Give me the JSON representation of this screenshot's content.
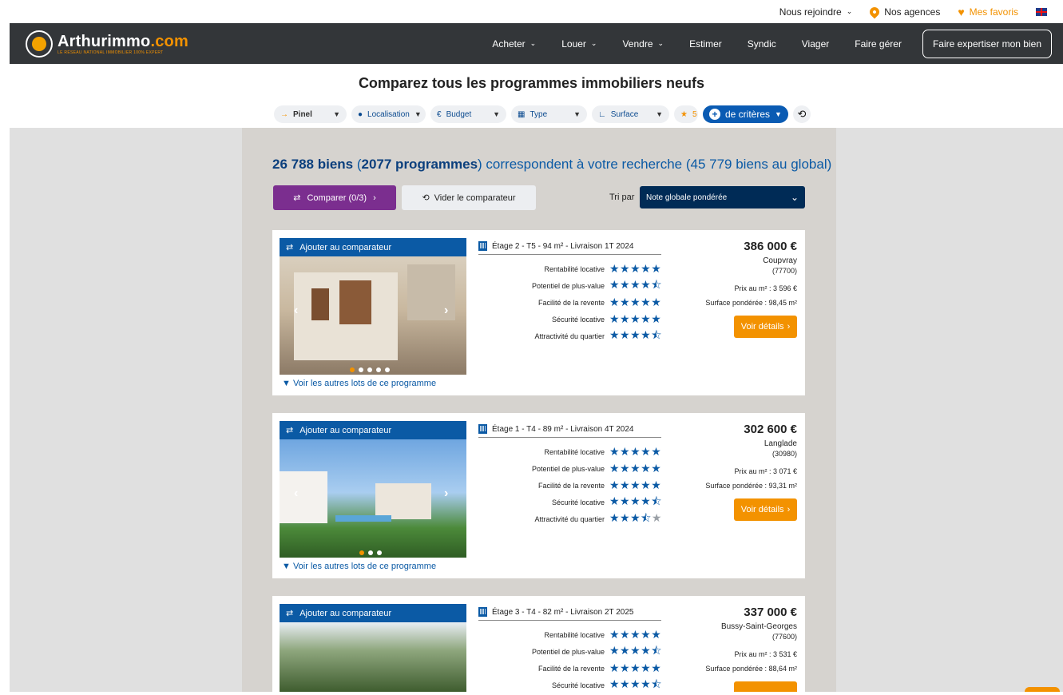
{
  "topbar": {
    "join": "Nous rejoindre",
    "agencies": "Nos agences",
    "favorites": "Mes favoris"
  },
  "nav": {
    "brand_main": "Arthurimmo",
    "brand_ext": ".com",
    "tagline": "LE RÉSEAU NATIONAL IMMOBILIER 100% EXPERT",
    "links": [
      "Acheter",
      "Louer",
      "Vendre",
      "Estimer",
      "Syndic",
      "Viager",
      "Faire gérer"
    ],
    "cta": "Faire expertiser mon bien"
  },
  "page_title": "Comparez tous les programmes immobiliers neufs",
  "filters": {
    "pinel": "Pinel",
    "location": "Localisation",
    "budget": "Budget",
    "type": "Type",
    "surface": "Surface",
    "stars": "5",
    "more": "de critères"
  },
  "results": {
    "biens": "26 788 biens",
    "open_paren": " (",
    "programmes": "2077 programmes",
    "rest": ") correspondent à votre recherche (45 779 biens au global)"
  },
  "actions": {
    "compare": "Comparer (0/3)",
    "clear": "Vider le comparateur",
    "sort_label": "Tri par",
    "sort_value": "Note globale pondérée"
  },
  "rating_labels": [
    "Rentabilité locative",
    "Potentiel de plus-value",
    "Facilité de la revente",
    "Sécurité locative",
    "Attractivité du quartier"
  ],
  "card_common": {
    "add_compare": "Ajouter au comparateur",
    "more_lots": "Voir les autres lots de ce programme",
    "details": "Voir détails"
  },
  "listings": [
    {
      "lot": "Étage 2 - T5 - 94 m² - Livraison 1T 2024",
      "price": "386 000 €",
      "city": "Coupvray",
      "zip": "(77700)",
      "price_m2": "Prix au m² : 3 596 €",
      "surface": "Surface pondérée : 98,45 m²",
      "ratings": [
        5,
        4.5,
        5,
        5,
        4.5
      ]
    },
    {
      "lot": "Étage 1 - T4 - 89 m² - Livraison 4T 2024",
      "price": "302 600 €",
      "city": "Langlade",
      "zip": "(30980)",
      "price_m2": "Prix au m² : 3 071 €",
      "surface": "Surface pondérée : 93,31 m²",
      "ratings": [
        5,
        5,
        5,
        4.5,
        3.5
      ]
    },
    {
      "lot": "Étage 3 - T4 - 82 m² - Livraison 2T 2025",
      "price": "337 000 €",
      "city": "Bussy-Saint-Georges",
      "zip": "(77600)",
      "price_m2": "Prix au m² : 3 531 €",
      "surface": "Surface pondérée : 88,64 m²",
      "ratings": [
        5,
        4.5,
        5,
        4.5
      ]
    }
  ],
  "colors": {
    "accent_orange": "#f39200",
    "brand_blue": "#0b5aa5",
    "compare_purple": "#7b2e8f",
    "nav_dark": "#333639"
  }
}
